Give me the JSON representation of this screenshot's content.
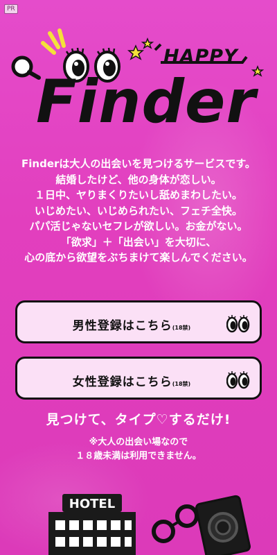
{
  "pr_badge": "PR",
  "logo": {
    "happy_text": "HAPPY",
    "brand": "Finder"
  },
  "intro_lines": [
    "Finderは大人の出会いを見つけるサービスです。",
    "結婚したけど、他の身体が恋しい。",
    "１日中、ヤりまくりたいし舐めまわしたい。",
    "いじめたい、いじめられたい、フェチ全快。",
    "パパ活じゃないセフレが欲しい。お金がない。",
    "「欲求」＋「出会い」を大切に、",
    "心の底から欲望をぶちまけて楽しんでください。"
  ],
  "buttons": {
    "male": {
      "label": "男性登録はこちら",
      "note": "(18禁)"
    },
    "female": {
      "label": "女性登録はこちら",
      "note": "(18禁)"
    }
  },
  "tagline": "見つけて、タイプ♡するだけ!",
  "notice_lines": [
    "※大人の出会い場なので",
    "１８歳未満は利用できません。"
  ],
  "hotel_sign": "HOTEL",
  "colors": {
    "background": "#e646c8",
    "button_fill": "#fbe0f6",
    "ink": "#111111",
    "star": "#f5e13a"
  }
}
